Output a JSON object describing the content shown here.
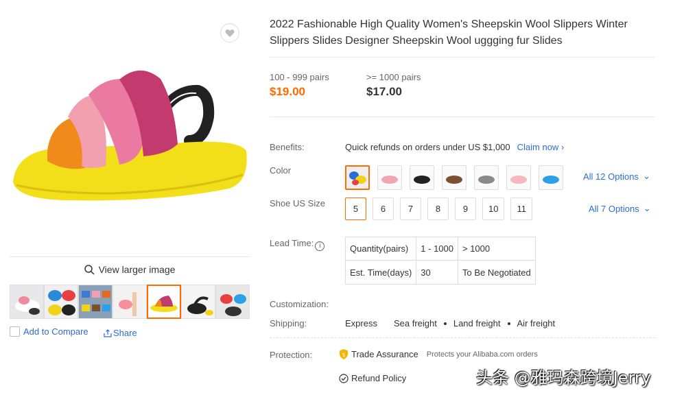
{
  "product": {
    "title": "2022 Fashionable High Quality Women's Sheepskin Wool Slippers Winter Slippers Slides Designer Sheepskin Wool uggging fur Slides"
  },
  "gallery": {
    "view_larger": "View larger image",
    "add_to_compare": "Add to Compare",
    "share": "Share",
    "thumbnail_count": 7,
    "active_thumbnail": 5
  },
  "pricing": {
    "tiers": [
      {
        "qty": "100 - 999 pairs",
        "price": "$19.00",
        "color": "#ff6a00"
      },
      {
        "qty": ">= 1000 pairs",
        "price": "$17.00",
        "color": "#333333"
      }
    ]
  },
  "benefits": {
    "label": "Benefits:",
    "text": "Quick refunds on orders under US $1,000",
    "link": "Claim now"
  },
  "color": {
    "label": "Color",
    "all_options": "All 12 Options",
    "swatch_colors": [
      "#f2d23a",
      "#f0a5b5",
      "#222222",
      "#7a5230",
      "#8a8a8a",
      "#f5b8c0",
      "#2aa0e8"
    ]
  },
  "size": {
    "label": "Shoe US Size",
    "options": [
      "5",
      "6",
      "7",
      "8",
      "9",
      "10",
      "11"
    ],
    "selected": "5",
    "all_options": "All 7 Options"
  },
  "lead_time": {
    "label": "Lead Time:",
    "rows": [
      [
        "Quantity(pairs)",
        "1 - 1000",
        "> 1000"
      ],
      [
        "Est. Time(days)",
        "30",
        "To Be Negotiated"
      ]
    ]
  },
  "customization": {
    "label": "Customization:"
  },
  "shipping": {
    "label": "Shipping:",
    "methods": [
      "Express",
      "Sea freight",
      "Land freight",
      "Air freight"
    ]
  },
  "protection": {
    "label": "Protection:",
    "trade_assurance": "Trade Assurance",
    "trade_sub": "Protects your Alibaba.com orders",
    "refund_policy": "Refund Policy"
  },
  "watermark": "头条 @雅玛森跨境Jerry",
  "colors": {
    "accent": "#ff6a00",
    "link": "#2a6cd6"
  }
}
